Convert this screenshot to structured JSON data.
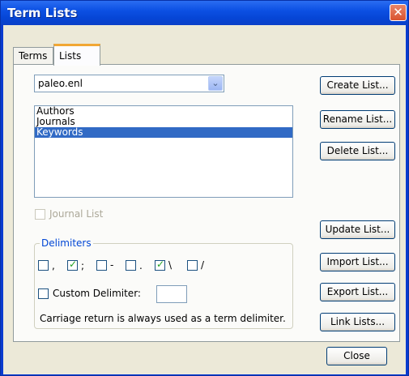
{
  "window": {
    "title": "Term Lists",
    "close_glyph": "✕"
  },
  "tabs": [
    {
      "label": "Terms",
      "active": false
    },
    {
      "label": "Lists",
      "active": true
    }
  ],
  "library_select": {
    "value": "paleo.enl",
    "dropdown_glyph": "⌄"
  },
  "lists": {
    "items": [
      {
        "label": "Authors",
        "selected": false
      },
      {
        "label": "Journals",
        "selected": false
      },
      {
        "label": "Keywords",
        "selected": true
      }
    ]
  },
  "buttons": {
    "create": "Create List...",
    "rename": "Rename List...",
    "delete": "Delete List...",
    "update": "Update List...",
    "import": "Import List...",
    "export": "Export List...",
    "link": "Link Lists...",
    "close": "Close"
  },
  "journal_list": {
    "label": "Journal List",
    "checked": false,
    "enabled": false
  },
  "delimiters": {
    "title": "Delimiters",
    "options": [
      {
        "char": ",",
        "checked": false
      },
      {
        "char": ";",
        "checked": true
      },
      {
        "char": "-",
        "checked": false
      },
      {
        "char": ".",
        "checked": false
      },
      {
        "char": "\\",
        "checked": true
      },
      {
        "char": "/",
        "checked": false
      }
    ],
    "custom": {
      "label": "Custom Delimiter:",
      "checked": false,
      "value": ""
    },
    "note": "Carriage return is always used as a term delimiter."
  },
  "colors": {
    "title_bar": "#0c50e3",
    "selection": "#316ac5",
    "group_title": "#0046d5",
    "active_tab_highlight": "#f1a734"
  }
}
